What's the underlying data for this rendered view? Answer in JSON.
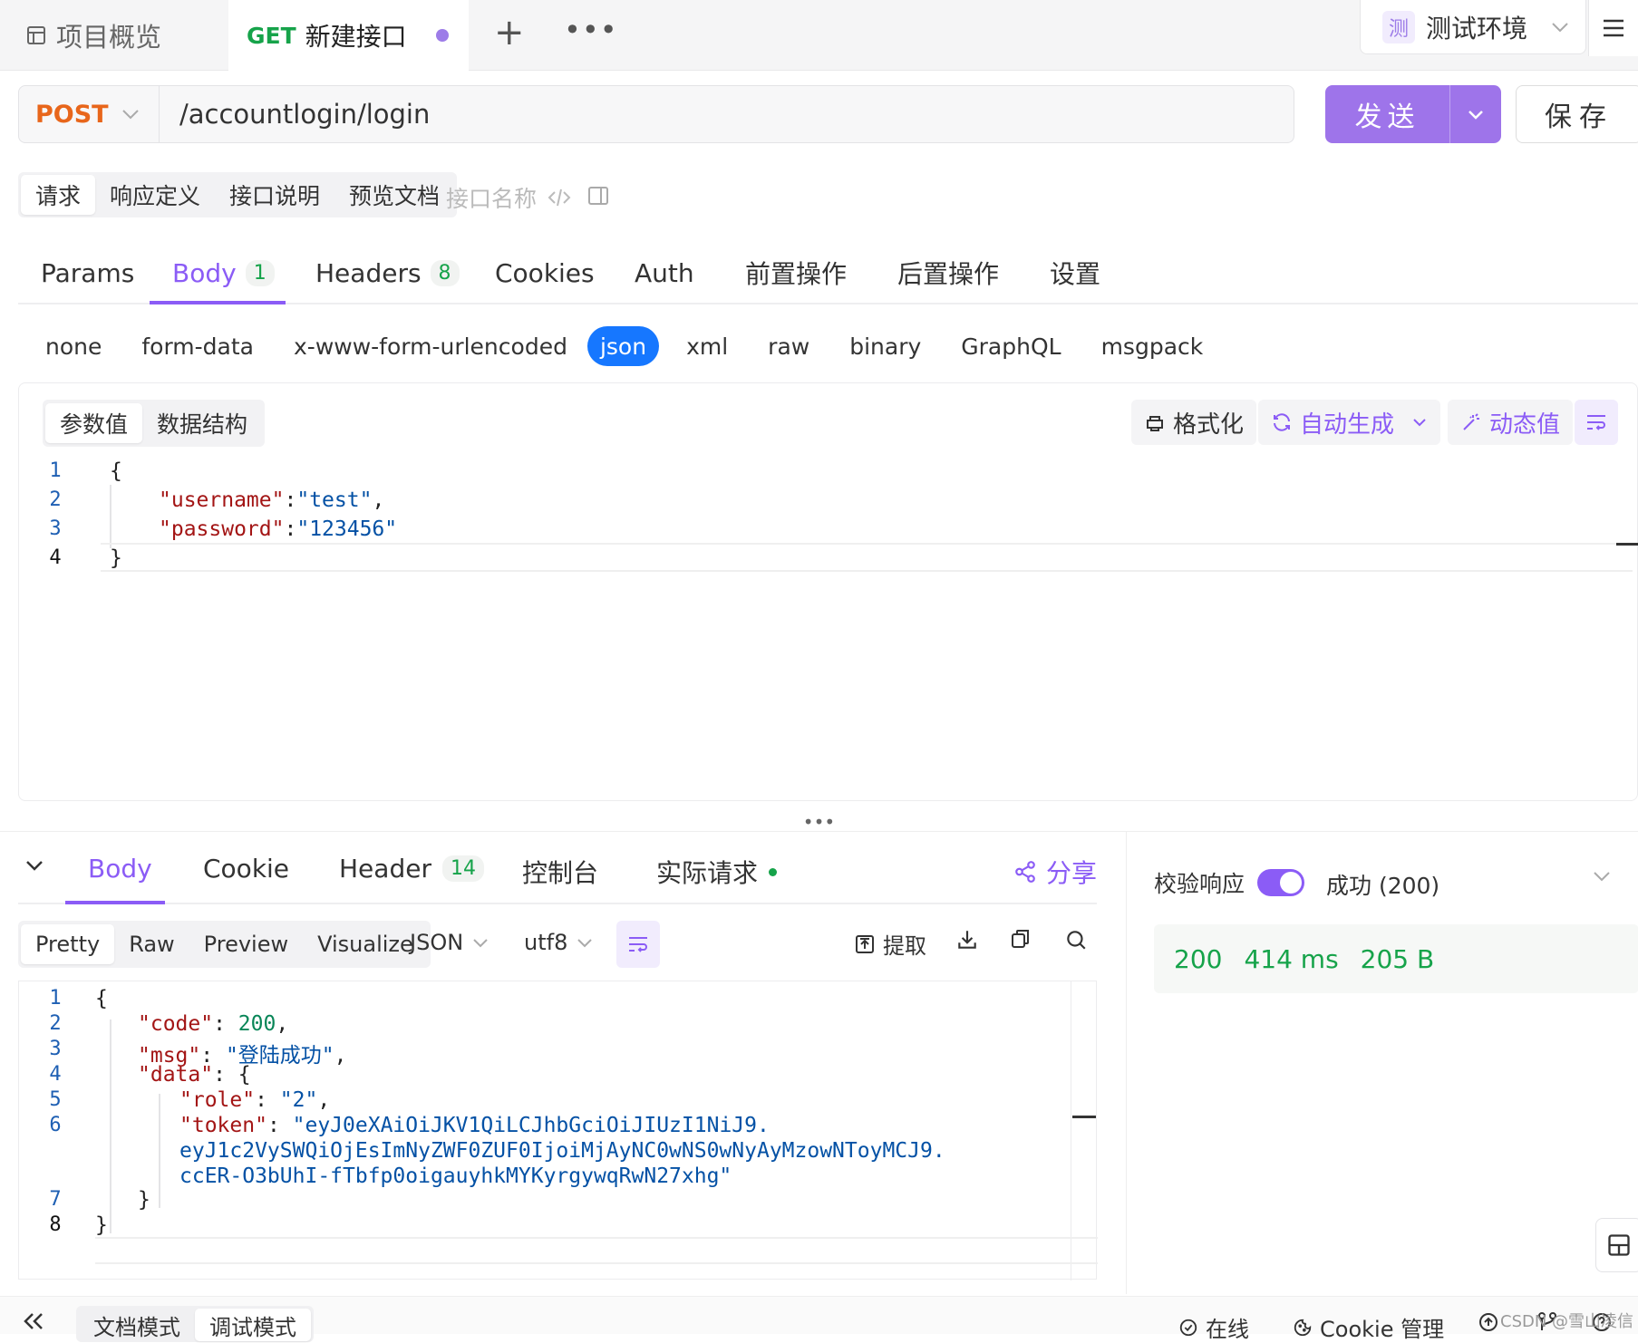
{
  "top_tabs": {
    "overview": "项目概览",
    "active_method": "GET",
    "active_title": "新建接口",
    "env_badge": "测",
    "env_name": "测试环境"
  },
  "request": {
    "method": "POST",
    "url": "/accountlogin/login",
    "send_label": "发送",
    "save_label": "保存"
  },
  "request_sections": [
    "请求",
    "响应定义",
    "接口说明",
    "预览文档"
  ],
  "api_name_placeholder": "接口名称",
  "main_tabs": [
    {
      "label": "Params",
      "count": ""
    },
    {
      "label": "Body",
      "count": "1"
    },
    {
      "label": "Headers",
      "count": "8"
    },
    {
      "label": "Cookies",
      "count": ""
    },
    {
      "label": "Auth",
      "count": ""
    },
    {
      "label": "前置操作",
      "count": ""
    },
    {
      "label": "后置操作",
      "count": ""
    },
    {
      "label": "设置",
      "count": ""
    }
  ],
  "body_types": [
    "none",
    "form-data",
    "x-www-form-urlencoded",
    "json",
    "xml",
    "raw",
    "binary",
    "GraphQL",
    "msgpack"
  ],
  "editor": {
    "modes": [
      "参数值",
      "数据结构"
    ],
    "format_label": "格式化",
    "autogen_label": "自动生成",
    "dynamic_label": "动态值",
    "line_numbers": [
      "1",
      "2",
      "3",
      "4"
    ],
    "lines": [
      [
        "{"
      ],
      [
        "\"username\"",
        ":",
        "\"test\"",
        ","
      ],
      [
        "\"password\"",
        ":",
        "\"123456\""
      ],
      [
        "}"
      ]
    ]
  },
  "response": {
    "tabs": [
      {
        "label": "Body",
        "count": ""
      },
      {
        "label": "Cookie",
        "count": ""
      },
      {
        "label": "Header",
        "count": "14"
      },
      {
        "label": "控制台",
        "count": ""
      },
      {
        "label": "实际请求",
        "count": ""
      }
    ],
    "share_label": "分享",
    "view_modes": [
      "Pretty",
      "Raw",
      "Preview",
      "Visualize"
    ],
    "format": "JSON",
    "encoding": "utf8",
    "extract_label": "提取",
    "line_numbers": [
      "1",
      "2",
      "3",
      "4",
      "5",
      "6",
      "",
      "",
      "7",
      "8"
    ],
    "code": {
      "l1": "{",
      "code_key": "\"code\"",
      "code_val": "200",
      "msg_key": "\"msg\"",
      "msg_val": "\"登陆成功\"",
      "data_key": "\"data\"",
      "role_key": "\"role\"",
      "role_val": "\"2\"",
      "token_key": "\"token\"",
      "token_l1": "\"eyJ0eXAiOiJKV1QiLCJhbGciOiJIUzI1NiJ9.",
      "token_l2": "eyJ1c2VySWQiOjEsImNyZWF0ZUF0IjoiMjAyNC0wNS0wNyAyMzowNToyMCJ9.",
      "token_l3": "ccER-O3bUhI-fTbfp0oigauyhkMYKyrgywqRwN27xhg\""
    },
    "verify_label": "校验响应",
    "result_label": "成功 (200)",
    "status": "200",
    "time": "414 ms",
    "size": "205 B"
  },
  "footer": {
    "doc_mode": "文档模式",
    "debug_mode": "调试模式",
    "online": "在线",
    "cookie_mgr": "Cookie 管理",
    "watermark": "CSDN @雪山凌信"
  }
}
